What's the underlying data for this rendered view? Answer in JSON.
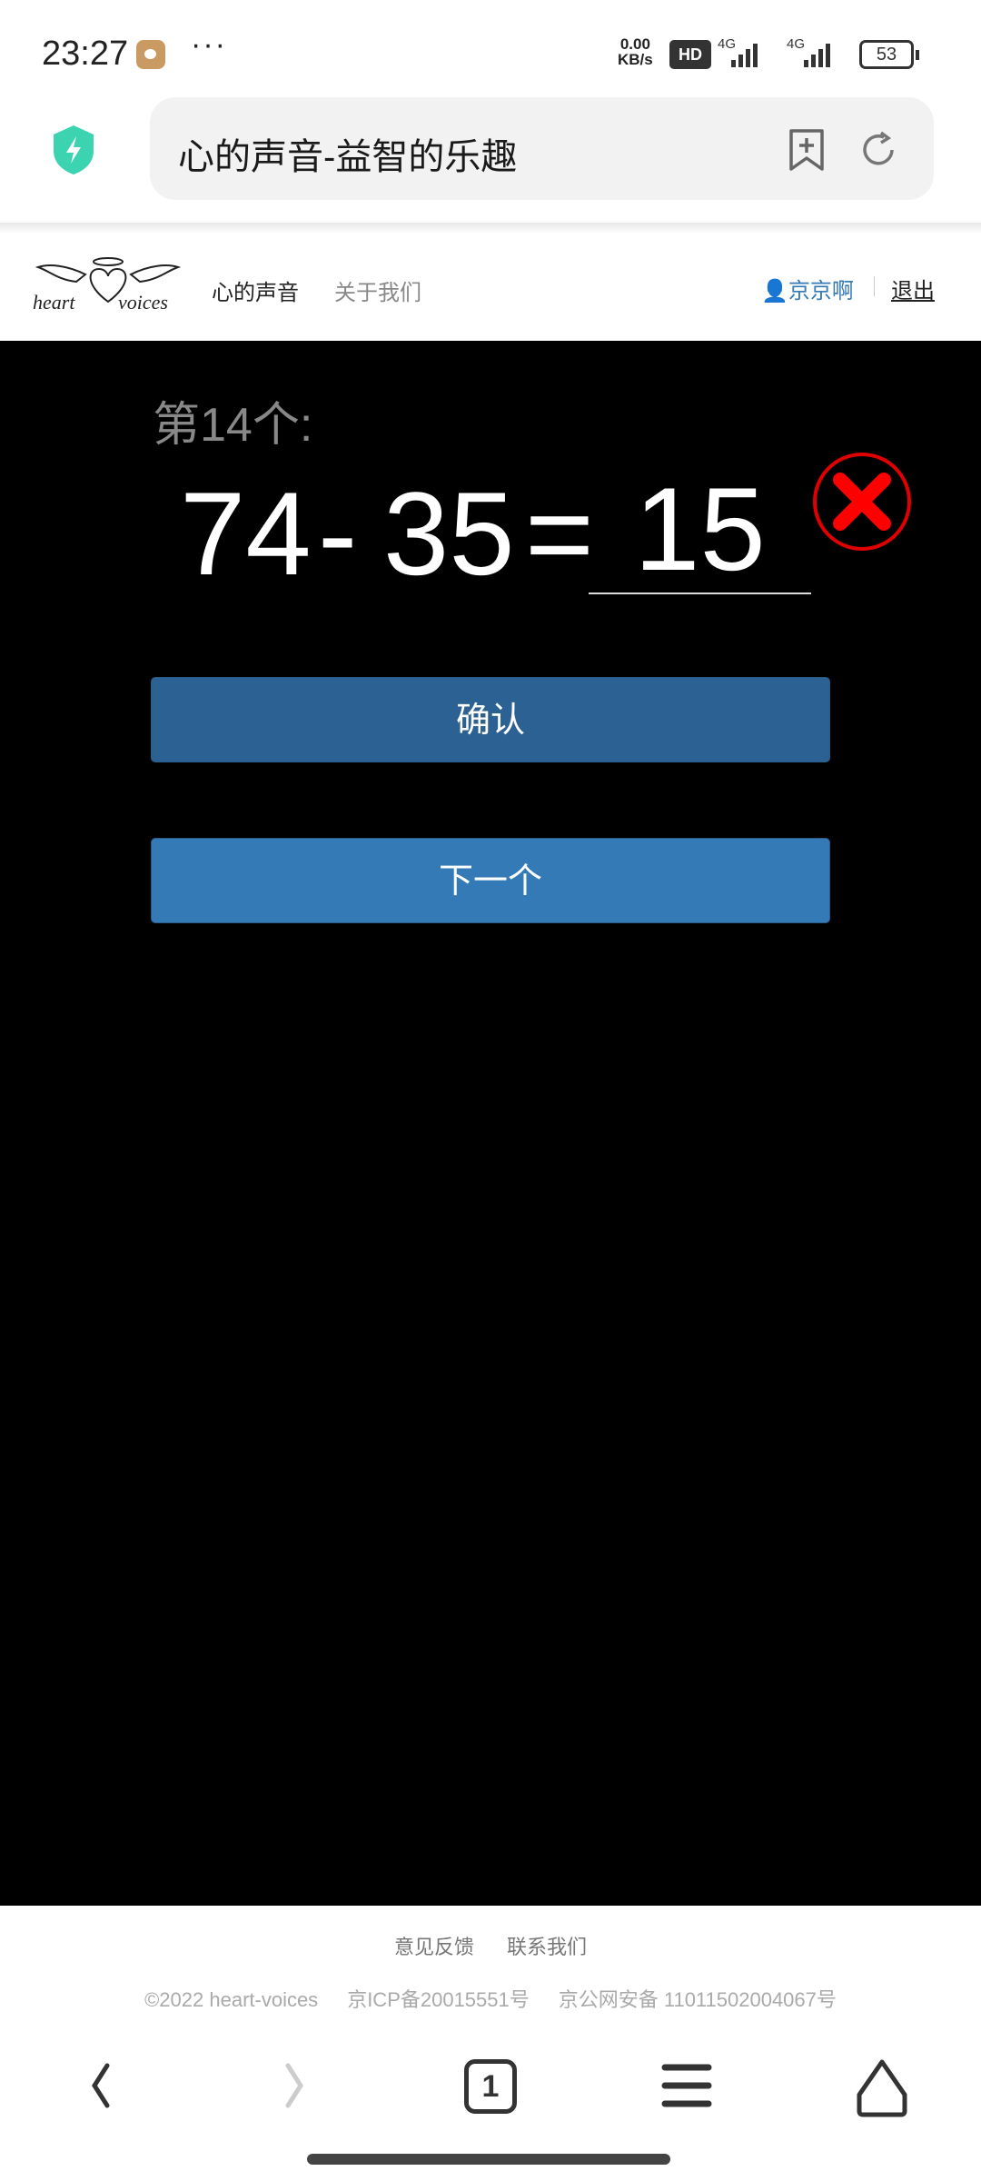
{
  "status_bar": {
    "time": "23:27",
    "net_speed_value": "0.00",
    "net_speed_unit": "KB/s",
    "hd": "HD",
    "sim1": "4G",
    "sim2": "4G",
    "battery": "53"
  },
  "browser": {
    "address_title": "心的声音-益智的乐趣",
    "tabs_count": "1"
  },
  "site_nav": {
    "logo_text": "heart voices",
    "items": [
      {
        "label": "心的声音"
      },
      {
        "label": "关于我们"
      }
    ],
    "user": "京京啊",
    "logout": "退出"
  },
  "quiz": {
    "question_label": "第14个:",
    "operand_a": "74",
    "operator": "-",
    "operand_b": "35",
    "equals": "=",
    "answer": "15",
    "result": "wrong",
    "confirm_label": "确认",
    "next_label": "下一个"
  },
  "footer": {
    "links": [
      "意见反馈",
      "联系我们"
    ],
    "copyright": "©2022 heart-voices",
    "icp": "京ICP备20015551号",
    "police": "京公网安备 11011502004067号"
  },
  "colors": {
    "confirm": "#2c6193",
    "next": "#337ab7",
    "wrong": "#e00000",
    "user_link": "#337ab7"
  }
}
